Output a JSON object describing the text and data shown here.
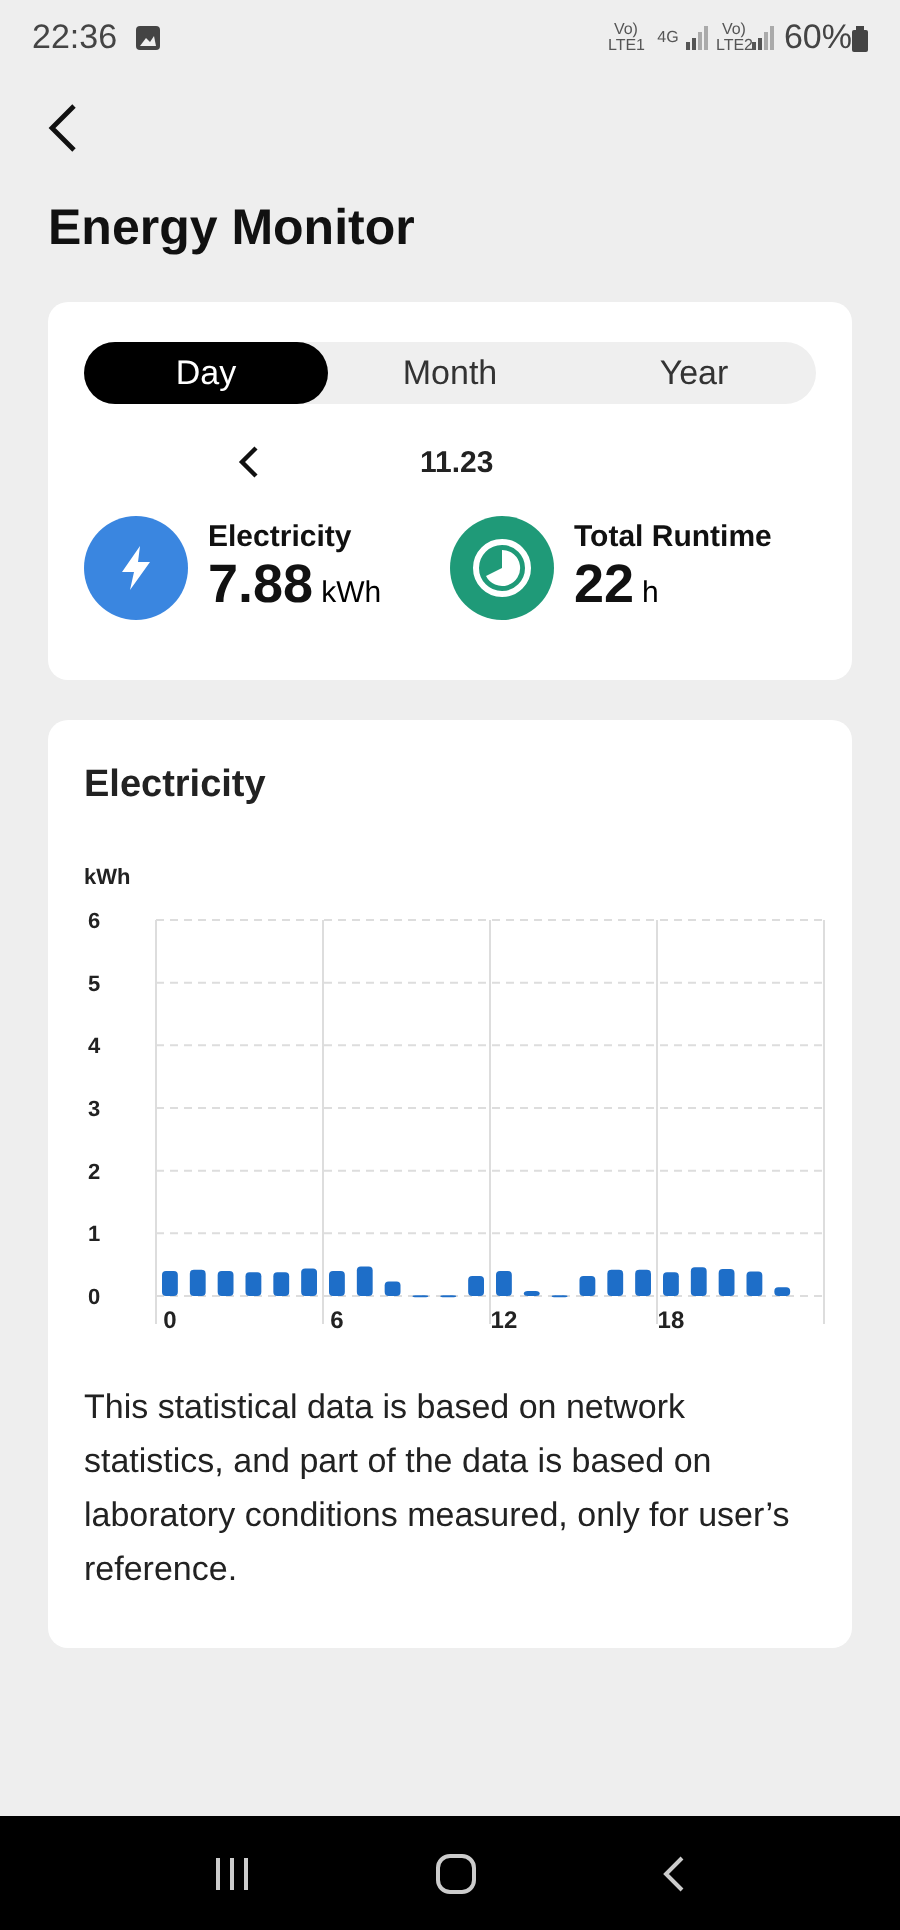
{
  "status_bar": {
    "time": "22:36",
    "network_labels": [
      "Vo) LTE1",
      "4G",
      "Vo) LTE2"
    ],
    "battery": "60%"
  },
  "header": {
    "title": "Energy Monitor"
  },
  "tabs": [
    {
      "label": "Day",
      "selected": true
    },
    {
      "label": "Month",
      "selected": false
    },
    {
      "label": "Year",
      "selected": false
    }
  ],
  "date": {
    "label": "11.23"
  },
  "stats": [
    {
      "kind": "electricity",
      "label": "Electricity",
      "value": "7.88",
      "unit": "kWh",
      "color": "#3a86e0"
    },
    {
      "kind": "runtime",
      "label": "Total Runtime",
      "value": "22",
      "unit": "h",
      "color": "#1f9a78"
    }
  ],
  "electricity_card": {
    "chart_data": {
      "type": "bar",
      "title": "Electricity",
      "ylabel": "kWh",
      "x": [
        0,
        1,
        2,
        3,
        4,
        5,
        6,
        7,
        8,
        9,
        10,
        11,
        12,
        13,
        14,
        15,
        16,
        17,
        18,
        19,
        20,
        21,
        22
      ],
      "grid": true,
      "xlim": [
        -0.5,
        23.5
      ],
      "series": [
        {
          "color": "#1e6ec8",
          "values": [
            0.4,
            0.42,
            0.4,
            0.38,
            0.38,
            0.44,
            0.4,
            0.47,
            0.23,
            0.01,
            0.01,
            0.32,
            0.4,
            0.08,
            0.01,
            0.32,
            0.42,
            0.42,
            0.38,
            0.46,
            0.43,
            0.39,
            0.14
          ]
        }
      ],
      "ylim": [
        0,
        6
      ],
      "yticks": [
        0,
        1,
        2,
        3,
        4,
        5,
        6
      ],
      "xticks": [
        0,
        6,
        12,
        18
      ]
    },
    "note": "This statistical data is based on network statistics, and part of the data is based on laboratory conditions measured, only for user’s reference."
  }
}
